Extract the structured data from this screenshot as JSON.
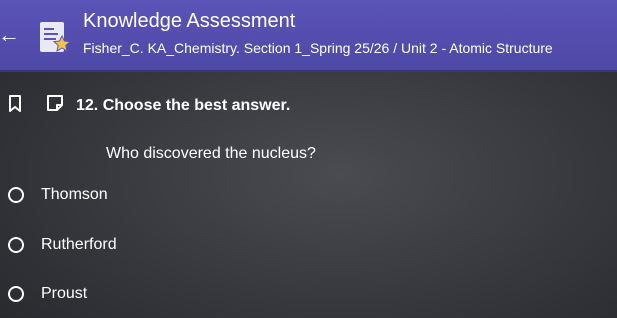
{
  "header": {
    "title": "Knowledge Assessment",
    "subtitle": "Fisher_C. KA_Chemistry. Section 1_Spring 25/26 / Unit 2 - Atomic Structure",
    "back_icon": "arrow-left-icon",
    "logo_icon": "assessment-logo-icon"
  },
  "question": {
    "heading": "12. Choose the best answer.",
    "text": "Who discovered the nucleus?",
    "bookmark_icon": "bookmark-icon",
    "flag_icon": "flag-icon"
  },
  "options": [
    {
      "label": "Thomson"
    },
    {
      "label": "Rutherford"
    },
    {
      "label": "Proust"
    }
  ],
  "colors": {
    "header_bg": "#5b54b8",
    "page_bg": "#36373c",
    "text": "#ffffff"
  }
}
